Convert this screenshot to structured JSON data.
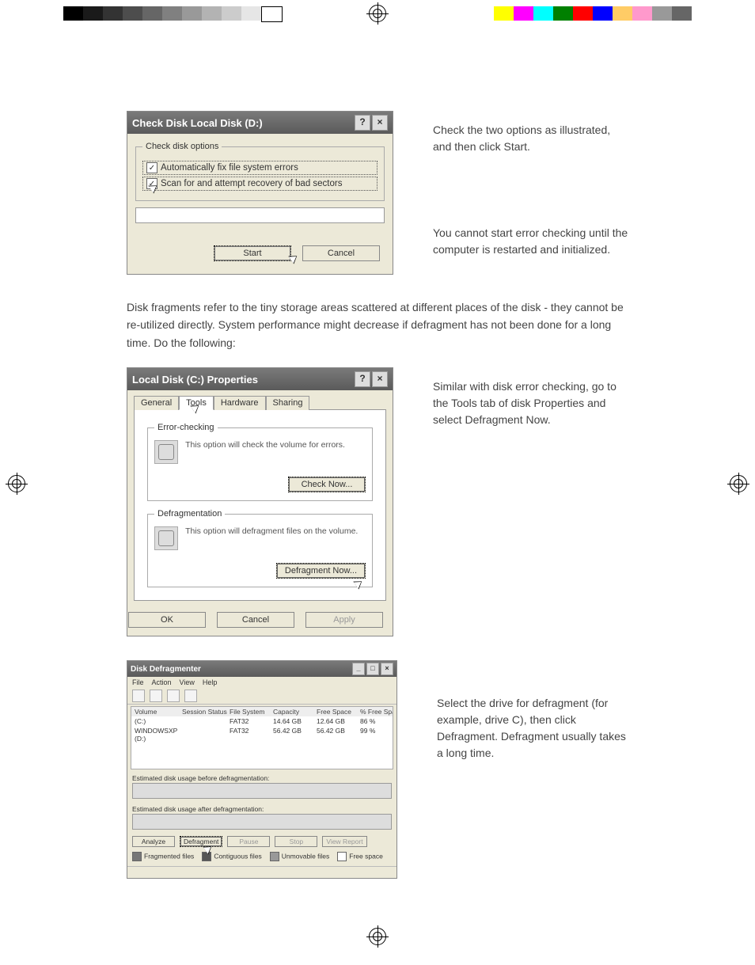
{
  "colorbar_left": [
    "#000000",
    "#1a1a1a",
    "#333333",
    "#4d4d4d",
    "#666666",
    "#808080",
    "#999999",
    "#b3b3b3",
    "#cccccc",
    "#e6e6e6",
    "#ffffff"
  ],
  "colorbar_right": [
    "#ffff00",
    "#ff00ff",
    "#00ffff",
    "#008000",
    "#ff0000",
    "#0000ff",
    "#ffcc66",
    "#ff99cc",
    "#999999",
    "#666666"
  ],
  "dialog1": {
    "title": "Check Disk Local Disk (D:)",
    "legend": "Check disk options",
    "opt1": "Automatically fix file system errors",
    "opt2": "Scan for and attempt recovery of bad sectors",
    "start": "Start",
    "cancel": "Cancel"
  },
  "text1a": "Check the two options as illustrated, and then click Start.",
  "text1b": "You cannot start error checking until the computer is restarted and initialized.",
  "para1": "Disk fragments refer to the tiny storage areas scattered at different places of the disk - they cannot be re-utilized directly. System performance might decrease if defragment has not been done for a long time. Do the following:",
  "dialog2": {
    "title": "Local Disk (C:) Properties",
    "tabs": {
      "general": "General",
      "tools": "Tools",
      "hardware": "Hardware",
      "sharing": "Sharing"
    },
    "error_legend": "Error-checking",
    "error_text": "This option will check the volume for errors.",
    "check_now": "Check Now...",
    "defrag_legend": "Defragmentation",
    "defrag_text": "This option will defragment files on the volume.",
    "defrag_now": "Defragment Now...",
    "ok": "OK",
    "cancel": "Cancel",
    "apply": "Apply"
  },
  "text2": "Similar with disk error checking, go to the Tools tab of disk Properties and select Defragment Now.",
  "defragwin": {
    "title": "Disk Defragmenter",
    "menus": [
      "File",
      "Action",
      "View",
      "Help"
    ],
    "headers": [
      "Volume",
      "Session Status",
      "File System",
      "Capacity",
      "Free Space",
      "% Free Space"
    ],
    "rows": [
      {
        "vol": "(C:)",
        "status": "",
        "fs": "FAT32",
        "cap": "14.64 GB",
        "free": "12.64 GB",
        "pct": "86 %"
      },
      {
        "vol": "WINDOWSXP (D:)",
        "status": "",
        "fs": "FAT32",
        "cap": "56.42 GB",
        "free": "56.42 GB",
        "pct": "99 %"
      }
    ],
    "before": "Estimated disk usage before defragmentation:",
    "after": "Estimated disk usage after defragmentation:",
    "buttons": {
      "analyze": "Analyze",
      "defragment": "Defragment",
      "pause": "Pause",
      "stop": "Stop",
      "view": "View Report"
    },
    "legend": {
      "frag": "Fragmented files",
      "contig": "Contiguous files",
      "unmov": "Unmovable files",
      "free": "Free space"
    }
  },
  "text3": "Select the drive for defragment (for example, drive C), then click Defragment. Defragment usually takes a long time."
}
